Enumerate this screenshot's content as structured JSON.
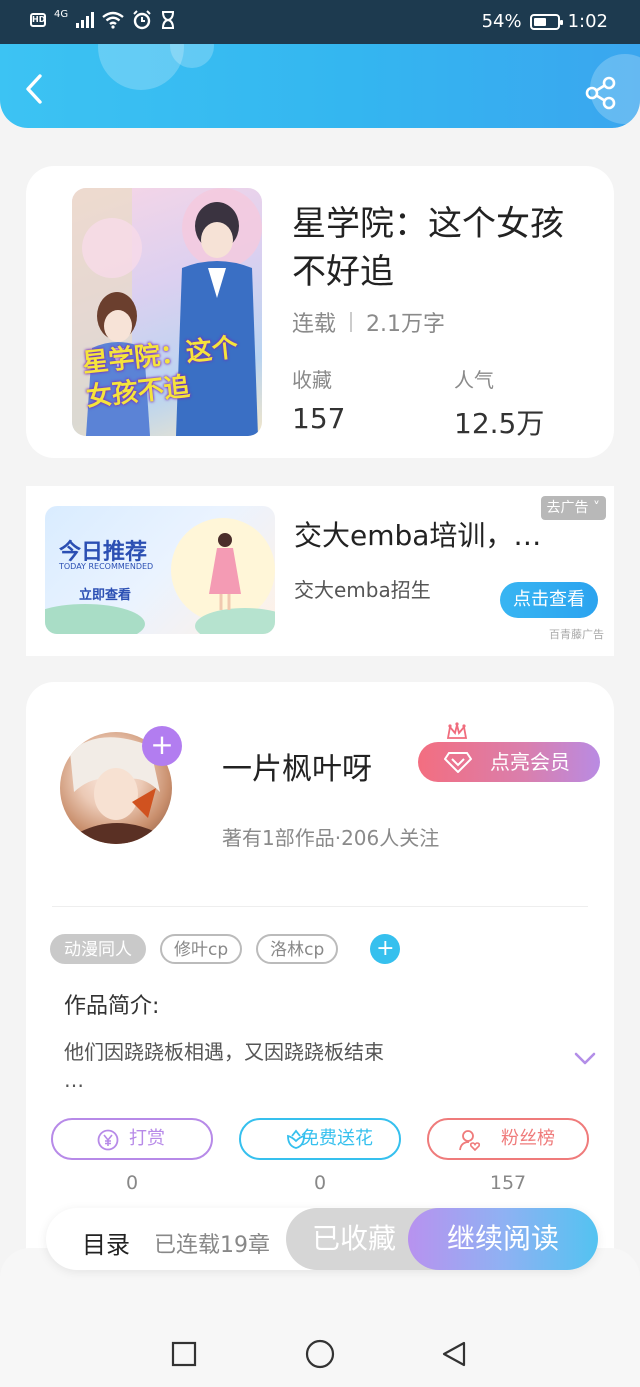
{
  "status_bar": {
    "left_badge": "HD",
    "network": "4G",
    "battery_percent": "54%",
    "battery_level": 0.54,
    "time": "1:02"
  },
  "header": {
    "back_icon": "chevron-left-icon",
    "share_icon": "share-icon",
    "gradient": [
      "#3cc3f3",
      "#3aa6ef"
    ]
  },
  "book": {
    "title": "星学院：这个女孩不好追",
    "status": "连载",
    "word_count": "2.1万字",
    "favorites_label": "收藏",
    "favorites_value": "157",
    "popularity_label": "人气",
    "popularity_value": "12.5万",
    "cover_text": "星学院：这个女孩不追"
  },
  "ad": {
    "banner_title": "今日推荐",
    "banner_subtitle": "TODAY RECOMMENDED",
    "banner_cta": "立即查看",
    "title": "交大emba培训，…",
    "subtitle": "交大emba招生",
    "close_label": "去广告",
    "button_label": "点击查看",
    "source": "百青藤广告"
  },
  "author": {
    "name": "一片枫叶呀",
    "info": "著有1部作品·206人关注",
    "vip_label": "点亮会员",
    "follow_icon": "plus-icon"
  },
  "tags": [
    "动漫同人",
    "修叶cp",
    "洛林cp"
  ],
  "intro": {
    "title": "作品简介:",
    "text": "他们因跷跷板相遇，又因跷跷板结束",
    "more": "…"
  },
  "actions": [
    {
      "label": "打赏",
      "count": "0",
      "icon": "yen-icon",
      "color": "#b78ae8"
    },
    {
      "label": "免费送花",
      "count": "0",
      "icon": "flower-icon",
      "color": "#36c0ee"
    },
    {
      "label": "粉丝榜",
      "count": "157",
      "icon": "fan-user-icon",
      "color": "#ef7b7b"
    }
  ],
  "read_bar": {
    "toc_label": "目录",
    "chapters_label": "已连载19章",
    "collected_label": "已收藏",
    "continue_label": "继续阅读"
  },
  "nav_bar": {
    "items": [
      "square-icon",
      "circle-icon",
      "triangle-back-icon"
    ]
  }
}
